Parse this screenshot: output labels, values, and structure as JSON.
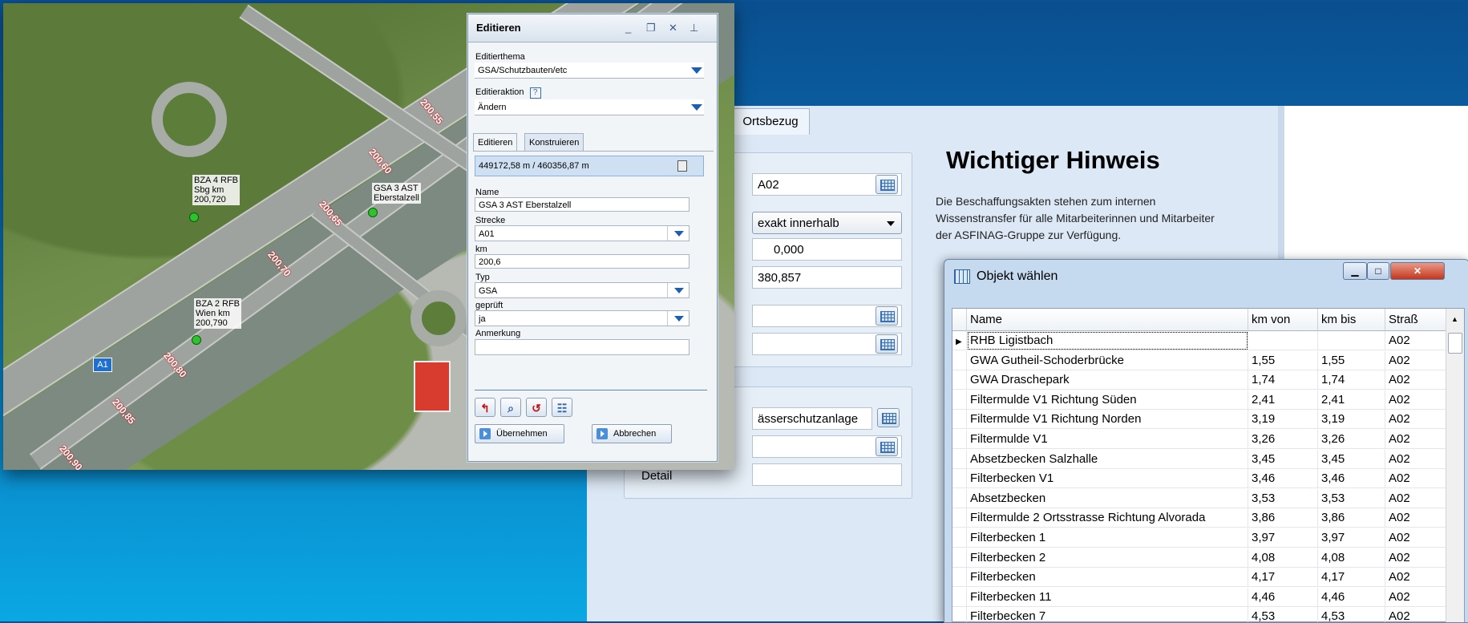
{
  "background_app": {
    "tab_label": "Ortsbezug",
    "fields": {
      "strasse_value": "A02",
      "lage_select": "exakt innerhalb",
      "km_from": "0,000",
      "km_to": "380,857",
      "anlage_value": "ässerschutzanlage",
      "detail_label": "Detail"
    },
    "hinweis": {
      "title": "Wichtiger Hinweis",
      "lines": [
        "Die Beschaffungsakten stehen zum internen",
        "Wissenstransfer für alle Mitarbeiterinnen und Mitarbeiter",
        "der ASFINAG-Gruppe zur Verfügung."
      ]
    }
  },
  "map": {
    "labels": [
      {
        "text": "BZA 4 RFB"
      },
      {
        "text": "Sbg km"
      },
      {
        "text": "200,720"
      },
      {
        "text": "GSA 3 AST"
      },
      {
        "text": "Eberstalzell"
      },
      {
        "text": "BZA 2 RFB"
      },
      {
        "text": "Wien km"
      },
      {
        "text": "200,790"
      }
    ],
    "km_ticks": [
      "200,55",
      "200,60",
      "200,65",
      "200,70",
      "200,80",
      "200,85",
      "200,90"
    ],
    "road_shield": "A1"
  },
  "edit_dialog": {
    "title": "Editieren",
    "editierthema_label": "Editierthema",
    "editierthema_value": "GSA/Schutzbauten/etc",
    "editieraktion_label": "Editieraktion",
    "editieraktion_value": "Ändern",
    "tabs": [
      "Editieren",
      "Konstruieren"
    ],
    "coordinates": "449172,58 m / 460356,87 m",
    "name_label": "Name",
    "name_value": "GSA 3 AST Eberstalzell",
    "strecke_label": "Strecke",
    "strecke_value": "A01",
    "km_label": "km",
    "km_value": "200,6",
    "typ_label": "Typ",
    "typ_value": "GSA",
    "geprueft_label": "geprüft",
    "geprueft_value": "ja",
    "anmerkung_label": "Anmerkung",
    "anmerkung_value": "",
    "ok_label": "Übernehmen",
    "cancel_label": "Abbrechen"
  },
  "object_window": {
    "title": "Objekt wählen",
    "columns": [
      "Name",
      "km von",
      "km bis",
      "Straß"
    ],
    "rows": [
      {
        "name": "RHB Ligistbach",
        "km_von": "",
        "km_bis": "",
        "strasse": "A02"
      },
      {
        "name": "GWA Gutheil-Schoderbrücke",
        "km_von": "1,55",
        "km_bis": "1,55",
        "strasse": "A02"
      },
      {
        "name": "GWA Draschepark",
        "km_von": "1,74",
        "km_bis": "1,74",
        "strasse": "A02"
      },
      {
        "name": "Filtermulde V1 Richtung Süden",
        "km_von": "2,41",
        "km_bis": "2,41",
        "strasse": "A02"
      },
      {
        "name": "Filtermulde V1 Richtung Norden",
        "km_von": "3,19",
        "km_bis": "3,19",
        "strasse": "A02"
      },
      {
        "name": "Filtermulde V1",
        "km_von": "3,26",
        "km_bis": "3,26",
        "strasse": "A02"
      },
      {
        "name": "Absetzbecken Salzhalle",
        "km_von": "3,45",
        "km_bis": "3,45",
        "strasse": "A02"
      },
      {
        "name": "Filterbecken V1",
        "km_von": "3,46",
        "km_bis": "3,46",
        "strasse": "A02"
      },
      {
        "name": "Absetzbecken",
        "km_von": "3,53",
        "km_bis": "3,53",
        "strasse": "A02"
      },
      {
        "name": "Filtermulde 2 Ortsstrasse Richtung Alvorada",
        "km_von": "3,86",
        "km_bis": "3,86",
        "strasse": "A02"
      },
      {
        "name": "Filterbecken 1",
        "km_von": "3,97",
        "km_bis": "3,97",
        "strasse": "A02"
      },
      {
        "name": "Filterbecken 2",
        "km_von": "4,08",
        "km_bis": "4,08",
        "strasse": "A02"
      },
      {
        "name": "Filterbecken",
        "km_von": "4,17",
        "km_bis": "4,17",
        "strasse": "A02"
      },
      {
        "name": "Filterbecken 11",
        "km_von": "4,46",
        "km_bis": "4,46",
        "strasse": "A02"
      },
      {
        "name": "Filterbecken 7",
        "km_von": "4,53",
        "km_bis": "4,53",
        "strasse": "A02"
      }
    ]
  }
}
